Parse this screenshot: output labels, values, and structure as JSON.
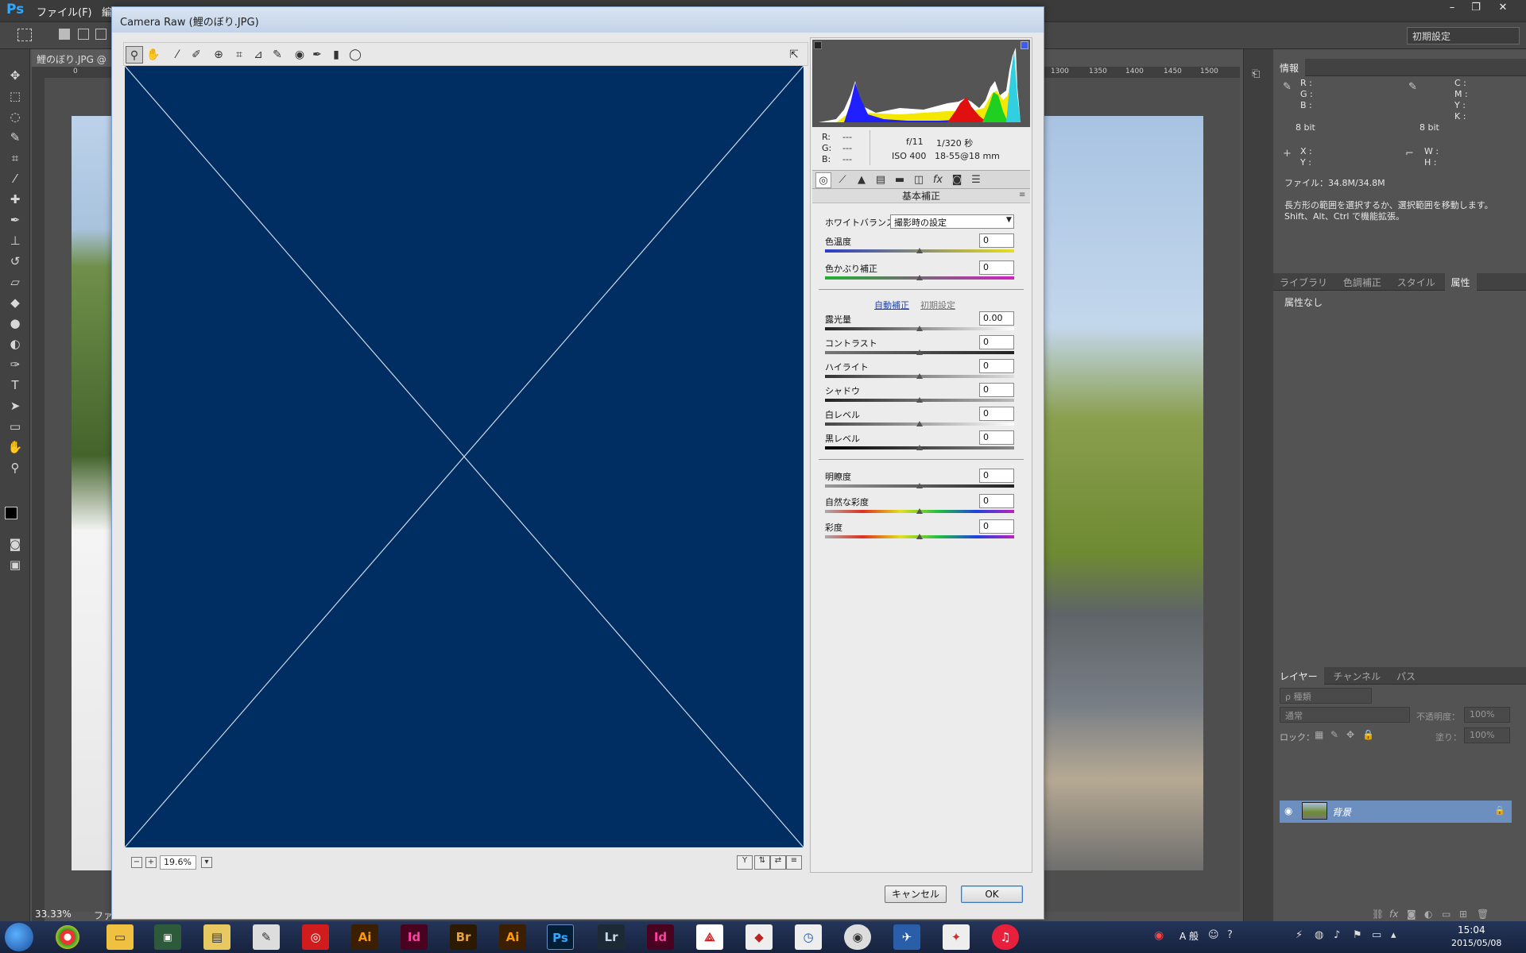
{
  "photoshop": {
    "logo": "Ps",
    "menu_file": "ファイル(F)",
    "menu_edit": "編",
    "workspace": "初期設定",
    "doc_tab": "鯉のぼり.JPG @",
    "zoom": "33.33%",
    "status_file": "ファ",
    "ruler_ticks": [
      "1300",
      "1350",
      "1400",
      "1450",
      "1500"
    ],
    "ruler_zero": "0"
  },
  "info_panel": {
    "tab": "情報",
    "rgb_labels": [
      "R :",
      "G :",
      "B :"
    ],
    "rgb_bit": "8 bit",
    "cmyk_labels": [
      "C :",
      "M :",
      "Y :",
      "K :"
    ],
    "cmyk_bit": "8 bit",
    "xy_labels": [
      "X :",
      "Y :"
    ],
    "wh_labels": [
      "W :",
      "H :"
    ],
    "file_size": "ファイル：34.8M/34.8M",
    "description_1": "長方形の範囲を選択するか、選択範囲を移動します。",
    "description_2": "Shift、Alt、Ctrl で機能拡張。"
  },
  "properties_panel": {
    "tabs": [
      "ライブラリ",
      "色調補正",
      "スタイル",
      "属性"
    ],
    "empty": "属性なし"
  },
  "layers_panel": {
    "tabs": [
      "レイヤー",
      "チャンネル",
      "パス"
    ],
    "filter": "ρ 種類",
    "blend_mode": "通常",
    "opacity_label": "不透明度：",
    "opacity_value": "100%",
    "lock_label": "ロック：",
    "fill_label": "塗り：",
    "fill_value": "100%",
    "layer_name": "背景"
  },
  "camera_raw": {
    "title": "Camera Raw (鯉のぼり.JPG)",
    "zoom_value": "19.6%",
    "exif": {
      "r": "R:",
      "g": "G:",
      "b": "B:",
      "r_val": "---",
      "g_val": "---",
      "b_val": "---",
      "aperture": "f/11",
      "shutter": "1/320 秒",
      "iso": "ISO 400",
      "lens": "18-55@18 mm"
    },
    "section_title": "基本補正",
    "white_balance_label": "ホワイトバランス：",
    "white_balance_value": "撮影時の設定",
    "auto_link": "自動補正",
    "default_link": "初期設定",
    "sliders": [
      {
        "label": "色温度",
        "value": "0"
      },
      {
        "label": "色かぶり補正",
        "value": "0"
      },
      {
        "label": "露光量",
        "value": "0.00"
      },
      {
        "label": "コントラスト",
        "value": "0"
      },
      {
        "label": "ハイライト",
        "value": "0"
      },
      {
        "label": "シャドウ",
        "value": "0"
      },
      {
        "label": "白レベル",
        "value": "0"
      },
      {
        "label": "黒レベル",
        "value": "0"
      },
      {
        "label": "明瞭度",
        "value": "0"
      },
      {
        "label": "自然な彩度",
        "value": "0"
      },
      {
        "label": "彩度",
        "value": "0"
      }
    ],
    "cancel_label": "キャンセル",
    "ok_label": "OK"
  },
  "taskbar": {
    "apps": [
      "Ai",
      "Id",
      "Br",
      "Ai",
      "Ps",
      "Lr",
      "Id"
    ],
    "ime": "A 般",
    "time": "15:04",
    "date": "2015/05/08"
  },
  "colors": {
    "preview_bg": "#002d62",
    "ps_blue": "#31a8ff",
    "layer_selected": "#6d8fbf"
  }
}
